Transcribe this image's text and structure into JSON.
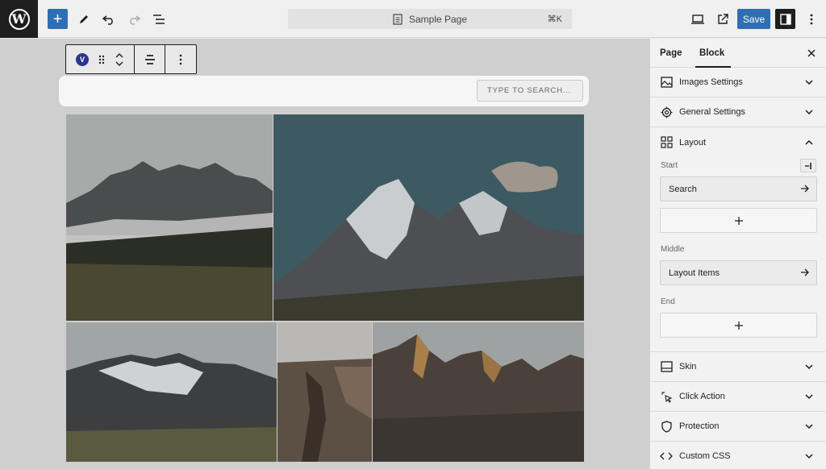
{
  "topbar": {
    "command_title": "Sample Page",
    "command_shortcut": "⌘K",
    "save_label": "Save"
  },
  "canvas": {
    "block_badge": "V",
    "search_placeholder": "TYPE TO SEARCH..."
  },
  "sidebar": {
    "tabs": [
      {
        "label": "Page",
        "active": false
      },
      {
        "label": "Block",
        "active": true
      }
    ],
    "panels_top": [
      {
        "label": "Images Settings",
        "icon": "image-icon"
      },
      {
        "label": "General Settings",
        "icon": "gear-icon"
      },
      {
        "label": "Layout",
        "icon": "layout-grid-icon",
        "expanded": true
      }
    ],
    "layout": {
      "start_label": "Start",
      "start_item": "Search",
      "middle_label": "Middle",
      "middle_item": "Layout Items",
      "end_label": "End"
    },
    "panels_bottom": [
      {
        "label": "Skin",
        "icon": "skin-icon"
      },
      {
        "label": "Click Action",
        "icon": "click-icon"
      },
      {
        "label": "Protection",
        "icon": "shield-icon"
      },
      {
        "label": "Custom CSS",
        "icon": "code-icon"
      }
    ]
  },
  "colors": {
    "accent": "#2f6eb3",
    "dark": "#1e1e1e",
    "block_badge": "#2b3590"
  }
}
